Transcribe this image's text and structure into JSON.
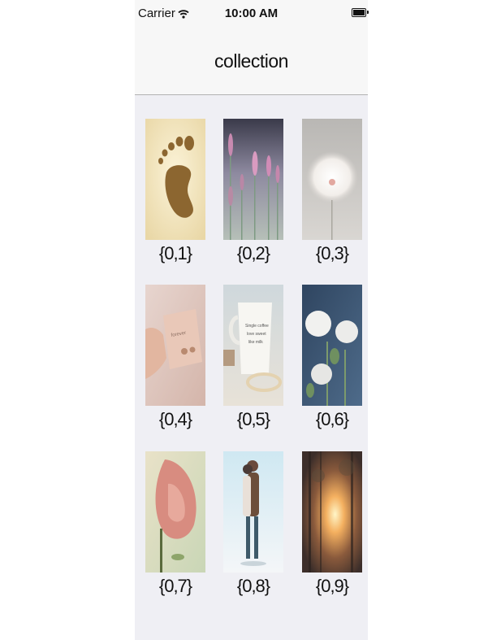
{
  "status_bar": {
    "carrier": "Carrier",
    "time": "10:00 AM",
    "wifi_icon": "wifi-icon",
    "battery_icon": "battery-icon"
  },
  "nav": {
    "title": "collection"
  },
  "items": [
    {
      "label": "{0,1}",
      "image": "footprint"
    },
    {
      "label": "{0,2}",
      "image": "lavender-flowers"
    },
    {
      "label": "{0,3}",
      "image": "dandelion"
    },
    {
      "label": "{0,4}",
      "image": "hand-holding-card"
    },
    {
      "label": "{0,5}",
      "image": "coffee-mug"
    },
    {
      "label": "{0,6}",
      "image": "white-roses"
    },
    {
      "label": "{0,7}",
      "image": "pink-rose"
    },
    {
      "label": "{0,8}",
      "image": "couple-in-snow"
    },
    {
      "label": "{0,9}",
      "image": "sunset-forest"
    }
  ],
  "colors": {
    "background": "#efeff4",
    "bar": "#f7f7f7",
    "separator": "#b2b2b2"
  }
}
